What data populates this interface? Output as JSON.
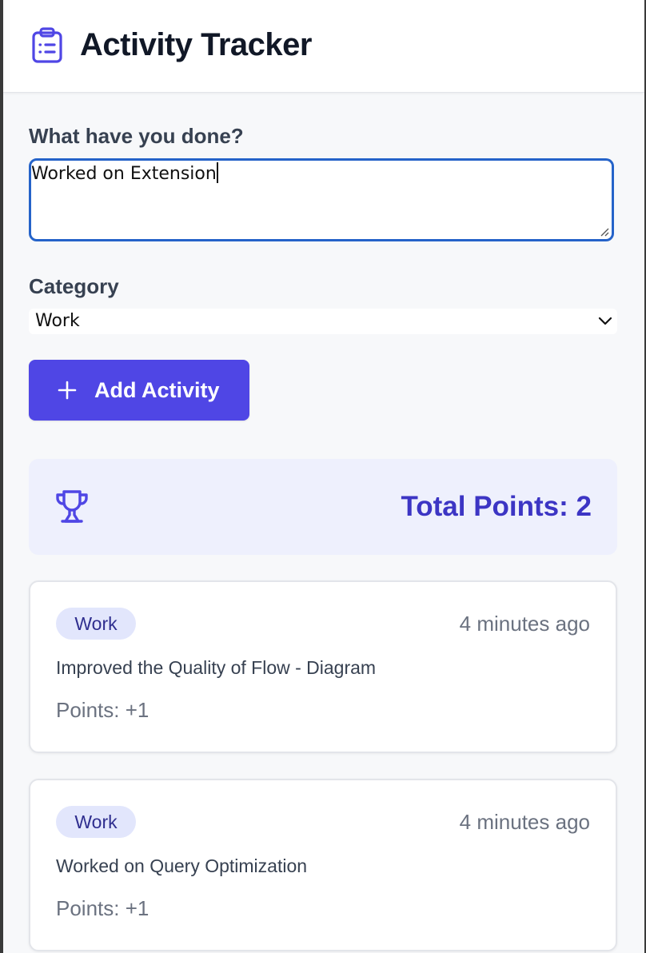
{
  "header": {
    "title": "Activity Tracker",
    "icon": "clipboard-list-icon"
  },
  "form": {
    "activity_label": "What have you done?",
    "activity_value": "Worked on Extension",
    "category_label": "Category",
    "category_value": "Work",
    "add_button_label": "Add Activity",
    "add_button_icon": "plus-icon"
  },
  "summary": {
    "icon": "trophy-icon",
    "total_points_text": "Total Points: 2"
  },
  "activities": [
    {
      "category": "Work",
      "time": "4 minutes ago",
      "description": "Improved the Quality of Flow - Diagram",
      "points": "Points: +1"
    },
    {
      "category": "Work",
      "time": "4 minutes ago",
      "description": "Worked on Query Optimization",
      "points": "Points: +1"
    }
  ],
  "colors": {
    "accent": "#4f46e5",
    "accent_text": "#3c35c4",
    "focus_border": "#2563c9",
    "badge_bg": "#e2e6fc",
    "panel_bg": "#eef0fd"
  }
}
